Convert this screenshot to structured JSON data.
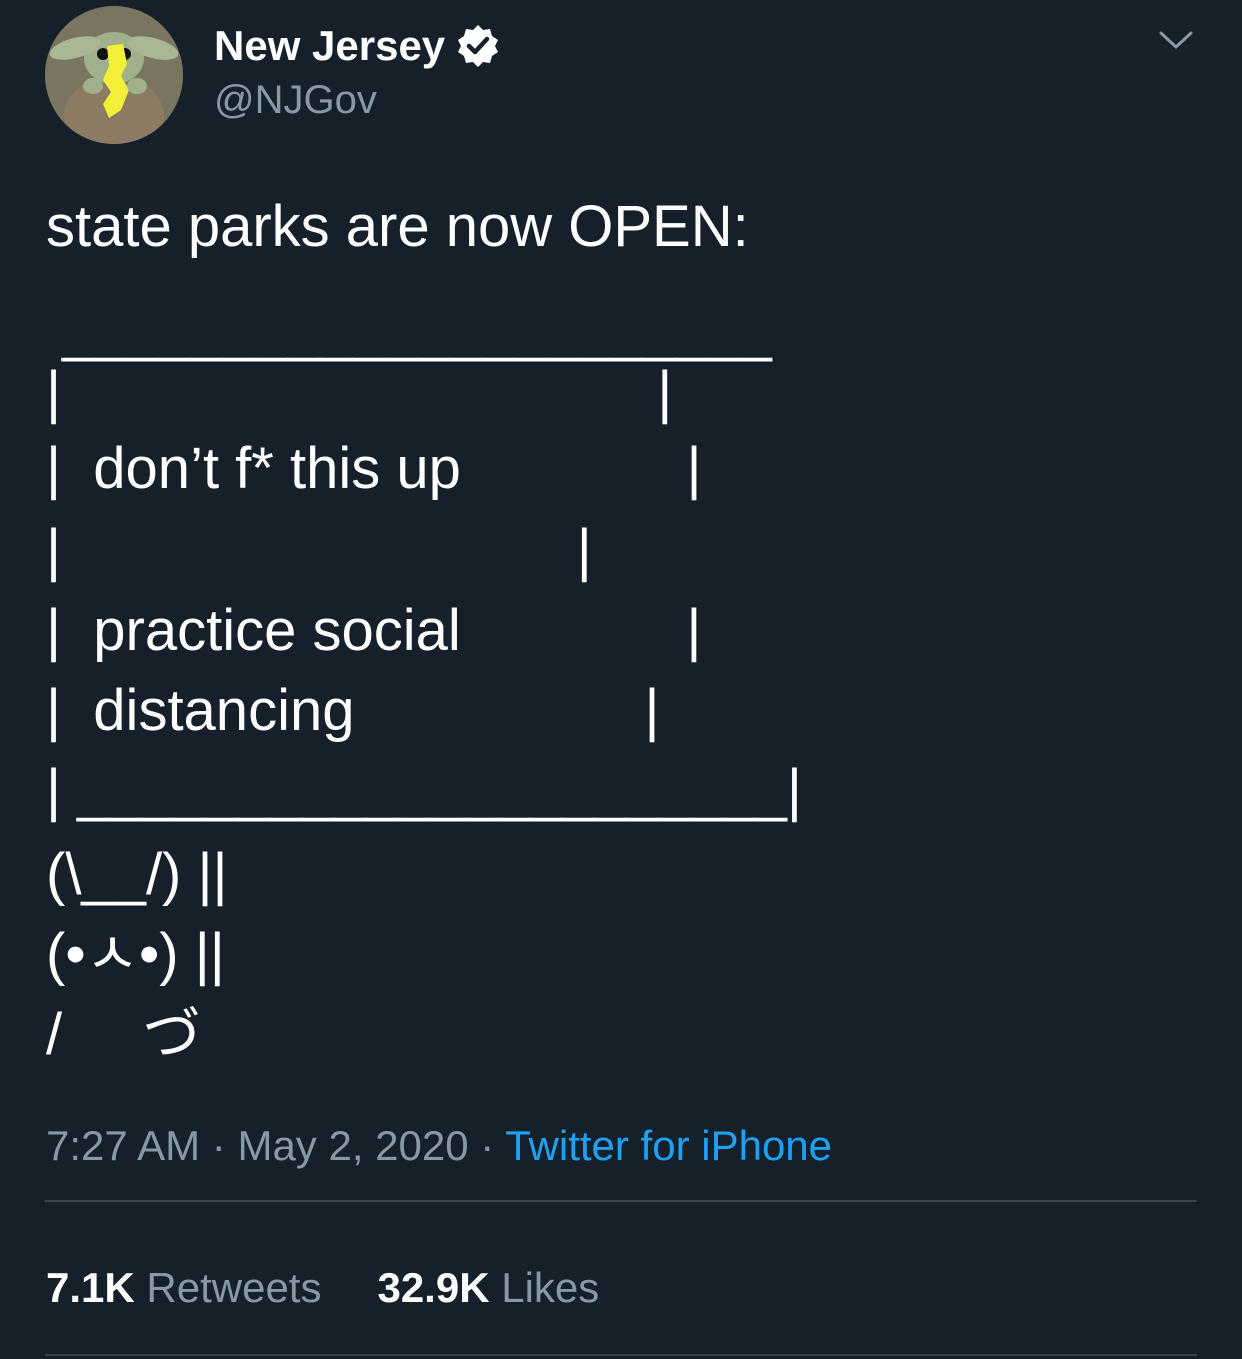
{
  "author": {
    "display_name": "New Jersey",
    "handle": "@NJGov",
    "verified": true,
    "avatar_icon": "baby-yoda-holding-new-jersey-avatar"
  },
  "tweet": {
    "lines": [
      "state parks are now OPEN:",
      " ______________________",
      "|                                     |",
      "|  don’t f* this up              |",
      "|                                |",
      "|  practice social              |",
      "|  distancing                  |",
      "| ______________________|",
      "(\\__/) ||",
      "(•ㅅ•) ||",
      "/     づ"
    ]
  },
  "meta": {
    "time": "7:27 AM",
    "separator": "·",
    "date": "May 2, 2020",
    "source": "Twitter for iPhone"
  },
  "stats": {
    "retweets_count": "7.1K",
    "retweets_label": "Retweets",
    "likes_count": "32.9K",
    "likes_label": "Likes"
  },
  "colors": {
    "background": "#15202b",
    "secondary_text": "#8899a6",
    "link": "#1da1f2",
    "divider": "#38444d"
  }
}
